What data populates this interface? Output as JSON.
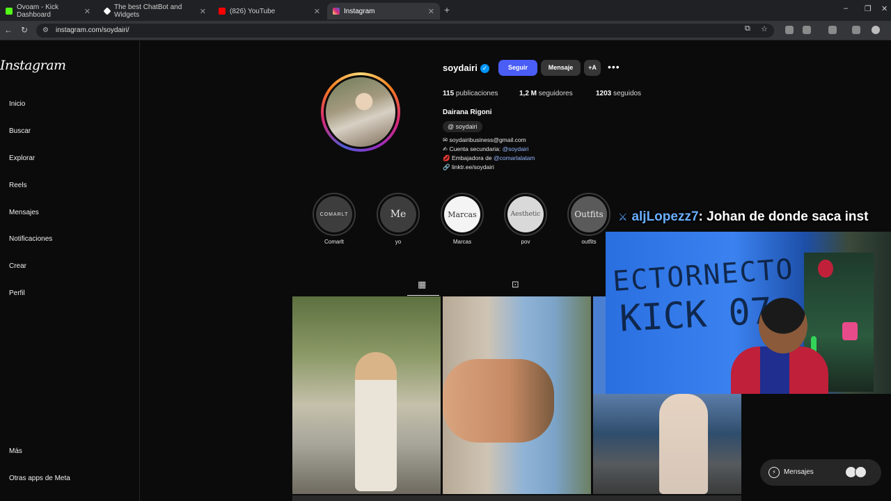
{
  "browser": {
    "tabs": [
      {
        "label": "Ovoam - Kick Dashboard",
        "active": false
      },
      {
        "label": "The best ChatBot and Widgets",
        "active": false
      },
      {
        "label": "(826) YouTube",
        "active": false
      },
      {
        "label": "Instagram",
        "active": true
      }
    ],
    "new_tab_glyph": "+",
    "window_controls": [
      "–",
      "❐",
      "✕"
    ],
    "url": "instagram.com/soydairi/"
  },
  "instagram": {
    "logo": "Instagram",
    "nav": [
      {
        "label": "Inicio"
      },
      {
        "label": "Buscar"
      },
      {
        "label": "Explorar"
      },
      {
        "label": "Reels"
      },
      {
        "label": "Mensajes"
      },
      {
        "label": "Notificaciones"
      },
      {
        "label": "Crear"
      },
      {
        "label": "Perfil"
      }
    ],
    "nav_bottom": [
      {
        "label": "Más"
      },
      {
        "label": "Otras apps de Meta"
      }
    ],
    "profile": {
      "username": "soydairi",
      "follow_label": "Seguir",
      "message_label": "Mensaje",
      "add_label": "+A",
      "more_label": "•••",
      "stats": [
        {
          "value": "115",
          "label": "publicaciones"
        },
        {
          "value": "1,2 M",
          "label": "seguidores"
        },
        {
          "value": "1203",
          "label": "seguidos"
        }
      ],
      "full_name": "Dairana Rigoni",
      "threads_handle": "soydairi",
      "bio": [
        {
          "text": "✉ soydairibusiness@gmail.com",
          "mention": ""
        },
        {
          "text": "✍ Cuenta secundaria: ",
          "mention": "@soydairi"
        },
        {
          "text": "💋 Embajadora de ",
          "mention": "@comarlalatam"
        },
        {
          "text": "🔗 linktr.ee/soydairi",
          "mention": ""
        }
      ]
    },
    "highlights": [
      {
        "label": "Comarlt",
        "cover": "COMARLT"
      },
      {
        "label": "yo",
        "cover": "Me"
      },
      {
        "label": "Marcas",
        "cover": "Marcas"
      },
      {
        "label": "pov",
        "cover": "Aesthetic"
      },
      {
        "label": "outfits",
        "cover": "Outfits"
      }
    ],
    "messages_label": "Mensajes"
  },
  "overlay": {
    "chat_user": "aljLopezz7",
    "chat_text": ": Johan de donde saca inst",
    "wall_text_1": "ECTORNECTO",
    "wall_text_2": "KICK 07"
  }
}
